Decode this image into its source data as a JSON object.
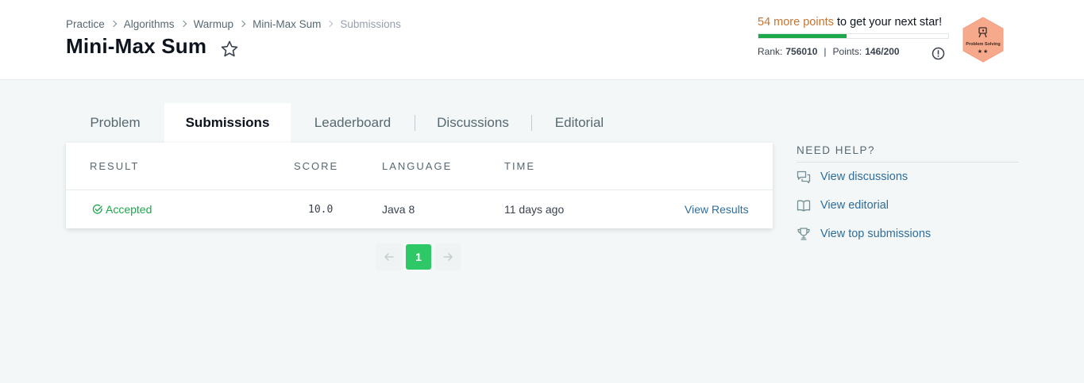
{
  "breadcrumb": {
    "items": [
      "Practice",
      "Algorithms",
      "Warmup",
      "Mini-Max Sum"
    ],
    "current": "Submissions"
  },
  "page": {
    "title": "Mini-Max Sum"
  },
  "progress": {
    "points_highlight": "54 more points",
    "points_rest": " to get your next star!",
    "fraction": 0.465,
    "rank_label": "Rank:",
    "rank_value": "756010",
    "separator": "|",
    "points_label": "Points:",
    "points_value": "146/200"
  },
  "badge": {
    "label": "Problem Solving",
    "stars": "★★",
    "color": "#f7a98c"
  },
  "tabs": [
    {
      "label": "Problem",
      "active": false
    },
    {
      "label": "Submissions",
      "active": true
    },
    {
      "label": "Leaderboard",
      "active": false
    },
    {
      "label": "Discussions",
      "active": false
    },
    {
      "label": "Editorial",
      "active": false
    }
  ],
  "table": {
    "headers": {
      "result": "RESULT",
      "score": "SCORE",
      "language": "LANGUAGE",
      "time": "TIME"
    },
    "rows": [
      {
        "result": "Accepted",
        "score": "10.0",
        "language": "Java 8",
        "time": "11 days ago",
        "action": "View Results"
      }
    ]
  },
  "pagination": {
    "prev_icon": "arrow-left-icon",
    "current": "1",
    "next_icon": "arrow-right-icon"
  },
  "help": {
    "title": "NEED HELP?",
    "links": [
      {
        "label": "View discussions",
        "icon": "discussions-icon"
      },
      {
        "label": "View editorial",
        "icon": "book-icon"
      },
      {
        "label": "View top submissions",
        "icon": "trophy-icon"
      }
    ]
  },
  "colors": {
    "accent_green": "#1ba94c",
    "link_blue": "#2e6d9e",
    "points_orange": "#c77432"
  }
}
